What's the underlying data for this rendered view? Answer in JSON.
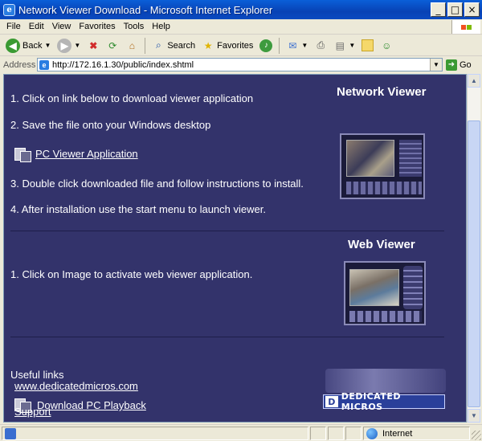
{
  "window": {
    "title": "Network Viewer Download - Microsoft Internet Explorer",
    "controls": [
      "_",
      "□",
      "×"
    ]
  },
  "menu": {
    "items": [
      "File",
      "Edit",
      "View",
      "Favorites",
      "Tools",
      "Help"
    ],
    "mnemonics": [
      "F",
      "E",
      "V",
      "a",
      "T",
      "H"
    ]
  },
  "toolbar": {
    "back_label": "Back",
    "search_label": "Search",
    "favorites_label": "Favorites"
  },
  "address": {
    "label": "Address",
    "url": "http://172.16.1.30/public/index.shtml",
    "go_label": "Go"
  },
  "page": {
    "network_viewer": {
      "heading": "Network Viewer",
      "step1": "1. Click on link below to download viewer application",
      "step2": "2. Save the file onto your Windows desktop",
      "download_link": "PC Viewer Application",
      "step3": "3. Double click downloaded file and follow instructions to install.",
      "step4": "4. After installation use the start menu to launch viewer."
    },
    "web_viewer": {
      "heading": "Web Viewer",
      "step1": "1. Click on Image to activate web viewer application."
    },
    "useful_links": {
      "heading": "Useful links",
      "site_link": "www.dedicatedmicros.com",
      "playback_link": "Download PC Playback",
      "support_link": "Support"
    },
    "logo_text": "DEDICATED MICROS",
    "logo_mark": "D"
  },
  "status": {
    "zone": "Internet"
  },
  "colors": {
    "page_background": "#33336b",
    "titlebar": "#0842b5",
    "logo_background": "#2a3f9a"
  }
}
